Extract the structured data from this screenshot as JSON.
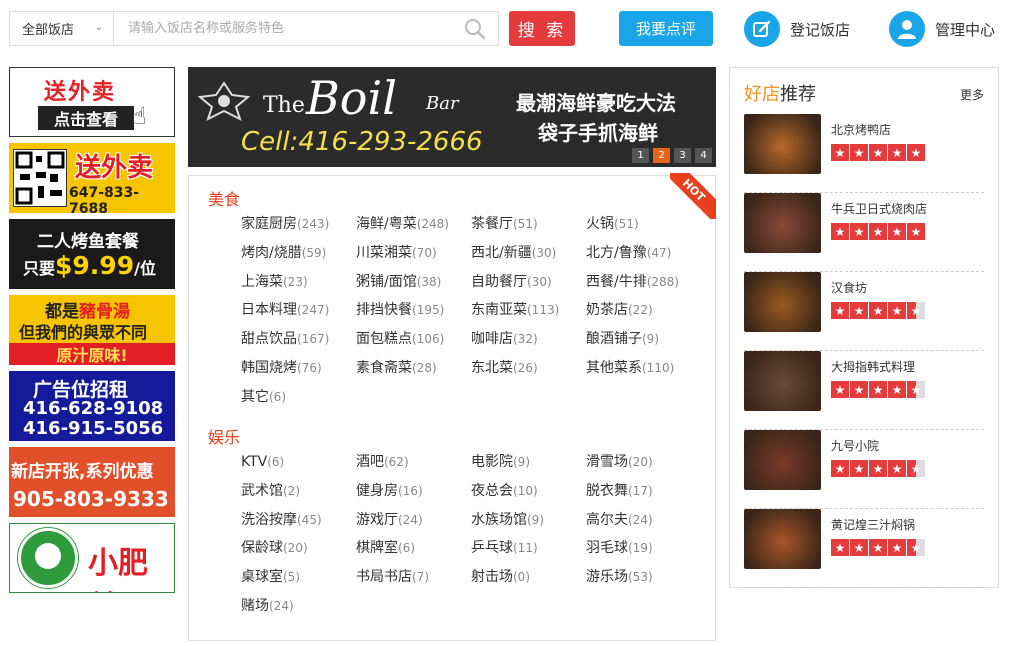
{
  "search": {
    "category": "全部饭店",
    "placeholder": "请输入饭店名称或服务特色",
    "button": "搜 索"
  },
  "header": {
    "review_button": "我要点评",
    "register_label": "登记饭店",
    "admin_label": "管理中心"
  },
  "ads": {
    "ad1": {
      "line1": "送外卖",
      "line2": "点击查看"
    },
    "ad2": {
      "line1": "送外卖",
      "phone": "647-833-7688"
    },
    "ad3": {
      "line1": "二人烤鱼套餐",
      "prefix": "只要",
      "price": "$9.99",
      "suffix": "/位"
    },
    "ad4": {
      "line1_a": "都是",
      "line1_b": "豬骨湯",
      "line2": "但我們的與眾不同",
      "line3": "原汁原味!"
    },
    "ad5": {
      "line1": "广告位招租",
      "phone1": "416-628-9108",
      "phone2": "416-915-5056"
    },
    "ad6": {
      "line1": "新店开张,系列优惠",
      "phone": "905-803-9333"
    },
    "ad7": {
      "brand": "小肥羊"
    }
  },
  "banner": {
    "logo_the": "The",
    "logo_boil": "Boil",
    "logo_bar": "Bar",
    "slogan1": "最潮海鲜豪吃大法",
    "slogan2": "袋子手抓海鲜",
    "cell": "Cell:416-293-2666",
    "slides": [
      "1",
      "2",
      "3",
      "4"
    ],
    "active_slide": 2
  },
  "categories": {
    "hot_badge": "HOT",
    "food": {
      "title": "美食",
      "items": [
        {
          "name": "家庭厨房",
          "count": "(243)"
        },
        {
          "name": "海鲜/粤菜",
          "count": "(248)"
        },
        {
          "name": "茶餐厅",
          "count": "(51)"
        },
        {
          "name": "火锅",
          "count": "(51)"
        },
        {
          "name": "烤肉/烧腊",
          "count": "(59)"
        },
        {
          "name": "川菜湘菜",
          "count": "(70)"
        },
        {
          "name": "西北/新疆",
          "count": "(30)"
        },
        {
          "name": "北方/鲁豫",
          "count": "(47)"
        },
        {
          "name": "上海菜",
          "count": "(23)"
        },
        {
          "name": "粥铺/面馆",
          "count": "(38)"
        },
        {
          "name": "自助餐厅",
          "count": "(30)"
        },
        {
          "name": "西餐/牛排",
          "count": "(288)"
        },
        {
          "name": "日本料理",
          "count": "(247)"
        },
        {
          "name": "排挡快餐",
          "count": "(195)"
        },
        {
          "name": "东南亚菜",
          "count": "(113)"
        },
        {
          "name": "奶茶店",
          "count": "(22)"
        },
        {
          "name": "甜点饮品",
          "count": "(167)"
        },
        {
          "name": "面包糕点",
          "count": "(106)"
        },
        {
          "name": "咖啡店",
          "count": "(32)"
        },
        {
          "name": "酿酒铺子",
          "count": "(9)"
        },
        {
          "name": "韩国烧烤",
          "count": "(76)"
        },
        {
          "name": "素食斋菜",
          "count": "(28)"
        },
        {
          "name": "东北菜",
          "count": "(26)"
        },
        {
          "name": "其他菜系",
          "count": "(110)"
        },
        {
          "name": "其它",
          "count": "(6)"
        }
      ]
    },
    "fun": {
      "title": "娱乐",
      "items": [
        {
          "name": "KTV",
          "count": "(6)"
        },
        {
          "name": "酒吧",
          "count": "(62)"
        },
        {
          "name": "电影院",
          "count": "(9)"
        },
        {
          "name": "滑雪场",
          "count": "(20)"
        },
        {
          "name": "武术馆",
          "count": "(2)"
        },
        {
          "name": "健身房",
          "count": "(16)"
        },
        {
          "name": "夜总会",
          "count": "(10)"
        },
        {
          "name": "脱衣舞",
          "count": "(17)"
        },
        {
          "name": "洗浴按摩",
          "count": "(45)"
        },
        {
          "name": "游戏厅",
          "count": "(24)"
        },
        {
          "name": "水族场馆",
          "count": "(9)"
        },
        {
          "name": "高尔夫",
          "count": "(24)"
        },
        {
          "name": "保龄球",
          "count": "(20)"
        },
        {
          "name": "棋牌室",
          "count": "(6)"
        },
        {
          "name": "乒乓球",
          "count": "(11)"
        },
        {
          "name": "羽毛球",
          "count": "(19)"
        },
        {
          "name": "桌球室",
          "count": "(5)"
        },
        {
          "name": "书局书店",
          "count": "(7)"
        },
        {
          "name": "射击场",
          "count": "(0)"
        },
        {
          "name": "游乐场",
          "count": "(53)"
        },
        {
          "name": "赌场",
          "count": "(24)"
        }
      ]
    }
  },
  "recommend": {
    "title_highlight": "好店",
    "title_rest": "推荐",
    "more": "更多",
    "items": [
      {
        "name": "北京烤鸭店",
        "rating": 5,
        "color": "#b86a2a"
      },
      {
        "name": "牛兵卫日式烧肉店",
        "rating": 5,
        "color": "#8a4a3a"
      },
      {
        "name": "汉食坊",
        "rating": 4.5,
        "color": "#9a5a20"
      },
      {
        "name": "大拇指韩式料理",
        "rating": 4.5,
        "color": "#6a4a3a"
      },
      {
        "name": "九号小院",
        "rating": 4.5,
        "color": "#7a3a2a"
      },
      {
        "name": "黄记煌三汁焖锅",
        "rating": 4.5,
        "color": "#a8562a"
      }
    ]
  },
  "colors": {
    "accent_red": "#e43c3c",
    "accent_blue": "#1aa5e8",
    "category_title": "#e8401c",
    "highlight_orange": "#f09420"
  }
}
